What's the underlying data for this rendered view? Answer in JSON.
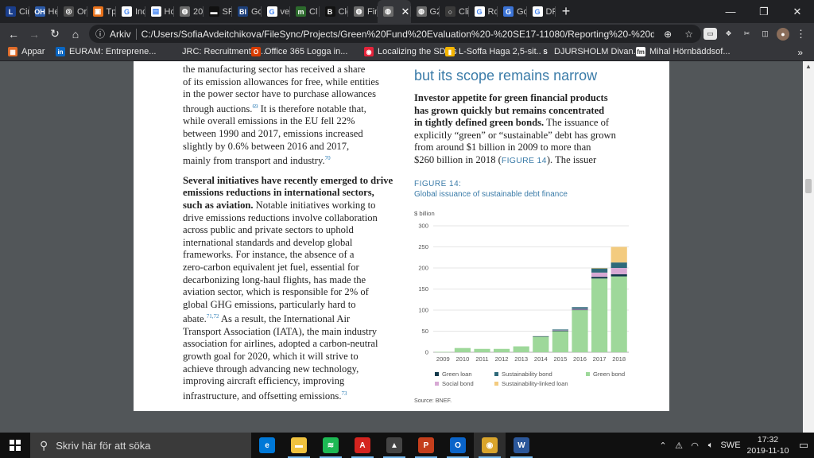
{
  "browser": {
    "tabs": [
      {
        "label": "Cir",
        "icon": "l-logo-icon",
        "color": "#1a3e8c",
        "glyph": "L"
      },
      {
        "label": "He",
        "icon": "ohi-icon",
        "color": "#2b5aa8",
        "glyph": "OH"
      },
      {
        "label": "Or",
        "icon": "chrome-icon",
        "color": "#4a4a4a",
        "glyph": "◎"
      },
      {
        "label": "Tp",
        "icon": "tp-icon",
        "color": "#e8711a",
        "glyph": "▣"
      },
      {
        "label": "Inc",
        "icon": "google-icon",
        "color": "#ffffff",
        "glyph": "G"
      },
      {
        "label": "Ho",
        "icon": "page-icon",
        "color": "#ffffff",
        "glyph": "▤"
      },
      {
        "label": "20",
        "icon": "globe-icon",
        "color": "#6b6b6b",
        "glyph": "◍"
      },
      {
        "label": "SP",
        "icon": "sp-icon",
        "color": "#111111",
        "glyph": "▬"
      },
      {
        "label": "Go",
        "icon": "bi-icon",
        "color": "#1c3f7a",
        "glyph": "BI"
      },
      {
        "label": "ver",
        "icon": "google-icon",
        "color": "#ffffff",
        "glyph": "G"
      },
      {
        "label": "Cl",
        "icon": "cl-icon",
        "color": "#2d6b2d",
        "glyph": "m"
      },
      {
        "label": "Cle",
        "icon": "b-icon",
        "color": "#111111",
        "glyph": "B"
      },
      {
        "label": "Fin",
        "icon": "globe-icon",
        "color": "#6b6b6b",
        "glyph": "◍"
      },
      {
        "label": "",
        "icon": "globe-icon",
        "color": "#6b6b6b",
        "glyph": "◍",
        "active": true
      },
      {
        "label": "G2",
        "icon": "globe-icon",
        "color": "#6b6b6b",
        "glyph": "◍"
      },
      {
        "label": "Cli",
        "icon": "circle-icon",
        "color": "#3a3a3a",
        "glyph": "○"
      },
      {
        "label": "Ro",
        "icon": "google-icon",
        "color": "#ffffff",
        "glyph": "G"
      },
      {
        "label": "Go",
        "icon": "translate-icon",
        "color": "#3b73d6",
        "glyph": "G"
      },
      {
        "label": "DF",
        "icon": "google-icon",
        "color": "#ffffff",
        "glyph": "G"
      }
    ],
    "address": {
      "scheme_label": "Arkiv",
      "url": "C:/Users/SofiaAvdeitchikova/FileSync/Projects/Green%20Fund%20Evaluation%20-%20SE17-11080/Reporting%20-%20delivery/R..."
    },
    "bookmarks": [
      {
        "label": "Appar",
        "icon": "apps-icon",
        "color": "#e06c2a",
        "glyph": "▦"
      },
      {
        "label": "EURAM: Entreprene...",
        "icon": "linkedin-icon",
        "color": "#0a66c2",
        "glyph": "in"
      },
      {
        "label": "JRC: Recruitment of...",
        "icon": "jrc-icon",
        "color": "#35363a",
        "glyph": ""
      },
      {
        "label": "Office 365 Logga in...",
        "icon": "office-icon",
        "color": "#d83b01",
        "glyph": "O"
      },
      {
        "label": "Localizing the SDGs",
        "icon": "sdg-icon",
        "color": "#e5243b",
        "glyph": "◉"
      },
      {
        "label": "L-Soffa Haga 2,5-sit...",
        "icon": "stripes-icon",
        "color": "#f4b400",
        "glyph": "▮"
      },
      {
        "label": "DJURSHOLM Divan...",
        "icon": "s-icon",
        "color": "#35363a",
        "glyph": "S"
      },
      {
        "label": "Mihal Hörnbäddsof...",
        "icon": "fm-icon",
        "color": "#ffffff",
        "glyph": "fm"
      }
    ]
  },
  "document": {
    "left_col": {
      "p1_lines": [
        "the manufacturing sector has received a share",
        "of its emission allowances for free, while entities",
        "in the power sector have to purchase allowances"
      ],
      "p1_l4_pre": "through auctions.",
      "p1_l4_sup": "69",
      "p1_l4_post": " It is therefore notable that,",
      "p1_lines_b": [
        "while overall emissions in the EU fell 22%",
        "between 1990 and 2017, emissions increased",
        "slightly by 0.6% between 2016 and 2017,"
      ],
      "p1_last": "mainly from transport and industry.",
      "p1_last_sup": "70",
      "p2_bold_lines": [
        "Several initiatives have recently emerged to drive",
        "emissions reductions in international sectors,"
      ],
      "p2_bold_end": "such as aviation.",
      "p2_l3_rest": " Notable initiatives working to",
      "p2_lines": [
        "drive emissions reductions involve collaboration",
        "across public and private sectors to uphold",
        "international standards and develop global",
        "frameworks. For instance, the absence of a",
        "zero-carbon equivalent jet fuel, essential for",
        "decarbonizing long-haul flights, has made the",
        "aviation sector, which is responsible for 2% of",
        "global GHG emissions, particularly hard to"
      ],
      "p2_abate": "abate.",
      "p2_abate_sup": "71,72",
      "p2_abate_rest": " As a result, the International Air",
      "p2_lines_b": [
        "Transport Association (IATA), the main industry",
        "association for airlines, adopted a carbon-neutral",
        "growth goal for 2020, which it will strive to",
        "achieve through advancing new technology,",
        "improving aircraft efficiency, improving"
      ],
      "p2_last": "infrastructure, and offsetting emissions.",
      "p2_last_sup": "73"
    },
    "right_col": {
      "heading": "but its scope remains narrow",
      "bold_lines": [
        "Investor appetite for green financial products",
        "has grown quickly but remains concentrated"
      ],
      "bold_end": "in tightly defined green bonds.",
      "l3_rest": " The issuance of",
      "lines": [
        "explicitly “green” or “sustainable” debt has grown",
        "from around $1 billion in 2009 to more than"
      ],
      "last_pre": "$260 billion in 2018 (",
      "last_ref": "FIGURE 14",
      "last_post": "). The issuer",
      "figure_label": "FIGURE 14:",
      "figure_title": "Global issuance of sustainable debt finance",
      "source": "Source: BNEF."
    }
  },
  "chart_data": {
    "type": "bar",
    "stacked": true,
    "unit_label": "$ billion",
    "categories": [
      "2009",
      "2010",
      "2011",
      "2012",
      "2013",
      "2014",
      "2015",
      "2016",
      "2017",
      "2018"
    ],
    "ylim": [
      0,
      300
    ],
    "yticks": [
      0,
      50,
      100,
      150,
      200,
      250,
      300
    ],
    "grid": true,
    "series": [
      {
        "name": "Green bond",
        "color": "#9ed89a",
        "values": [
          1,
          10,
          8,
          8,
          14,
          37,
          50,
          100,
          175,
          180
        ]
      },
      {
        "name": "Green loan",
        "color": "#12384a",
        "values": [
          0,
          0,
          0,
          0,
          0,
          1,
          1,
          1,
          4,
          5
        ]
      },
      {
        "name": "Social bond",
        "color": "#d7a9d4",
        "values": [
          0,
          0,
          0,
          0,
          0,
          0,
          1,
          2,
          10,
          15
        ]
      },
      {
        "name": "Sustainability bond",
        "color": "#2f6a7a",
        "values": [
          0,
          0,
          0,
          0,
          0,
          0,
          2,
          4,
          10,
          13
        ]
      },
      {
        "name": "Sustainability-linked loan",
        "color": "#f3cb7f",
        "values": [
          0,
          0,
          0,
          0,
          0,
          0,
          0,
          0,
          1,
          37
        ]
      }
    ],
    "legend_order": [
      "Green loan",
      "Sustainability bond",
      "Green bond",
      "Social bond",
      "Sustainability-linked loan"
    ],
    "legend_position": "bottom"
  },
  "taskbar": {
    "search_placeholder": "Skriv här för att söka",
    "apps": [
      {
        "icon": "task-view-icon",
        "color": "#101010",
        "glyph": "⧉"
      },
      {
        "icon": "edge-icon",
        "color": "#0078d7",
        "glyph": "e"
      },
      {
        "icon": "file-explorer-icon",
        "color": "#f0c23e",
        "glyph": "▬"
      },
      {
        "icon": "spotify-icon",
        "color": "#1db954",
        "glyph": "≋"
      },
      {
        "icon": "acrobat-icon",
        "color": "#d4231f",
        "glyph": "A"
      },
      {
        "icon": "photos-icon",
        "color": "#444444",
        "glyph": "▲"
      },
      {
        "icon": "powerpoint-icon",
        "color": "#c43e1c",
        "glyph": "P"
      },
      {
        "icon": "outlook-icon",
        "color": "#0a64c9",
        "glyph": "O"
      },
      {
        "icon": "chrome-icon",
        "color": "#d9a42b",
        "glyph": "◉"
      },
      {
        "icon": "word-icon",
        "color": "#2b579a",
        "glyph": "W"
      }
    ],
    "language": "SWE",
    "time": "17:32",
    "date": "2019-11-10"
  }
}
